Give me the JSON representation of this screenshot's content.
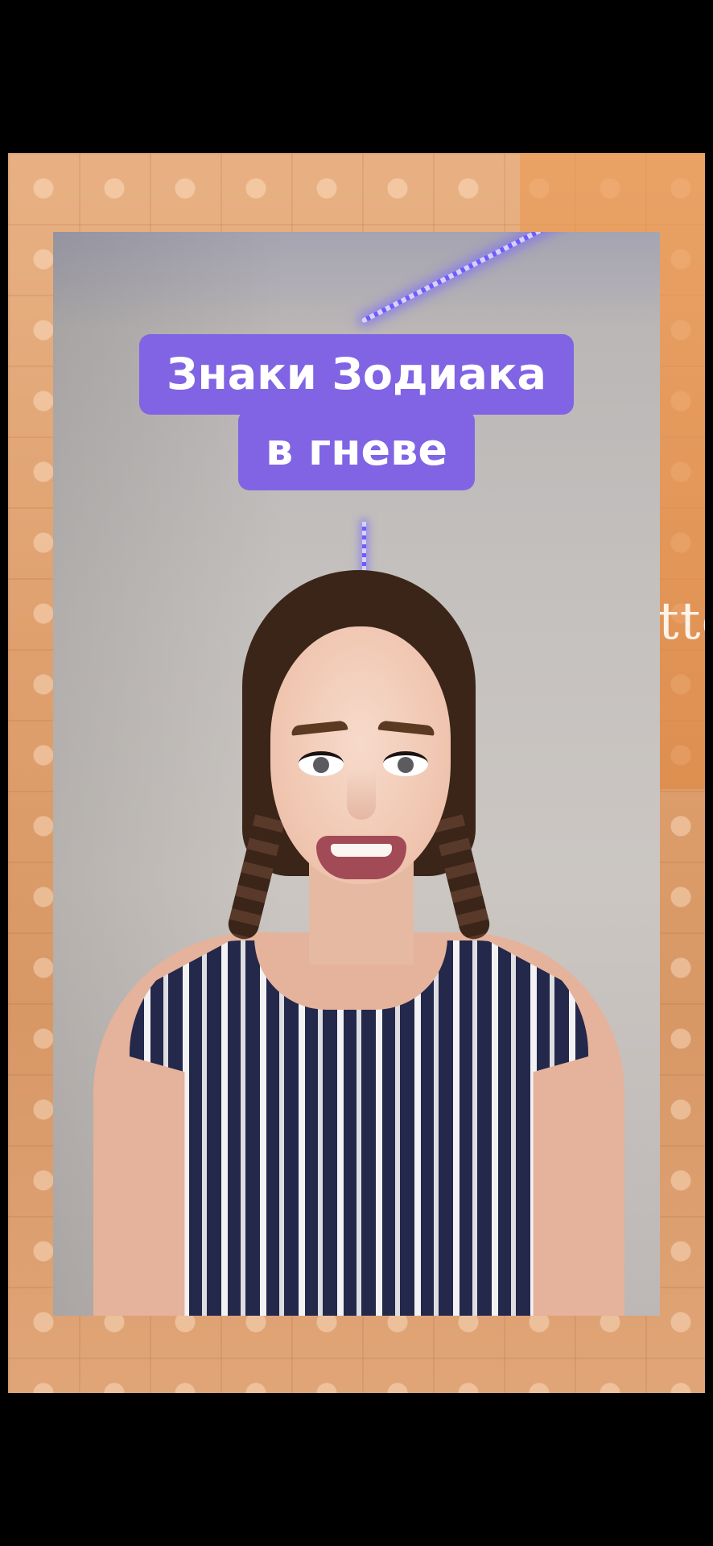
{
  "video": {
    "caption_lines": [
      "Знаки Зодиака",
      "в гневе"
    ],
    "background_partial_text": "tto"
  }
}
